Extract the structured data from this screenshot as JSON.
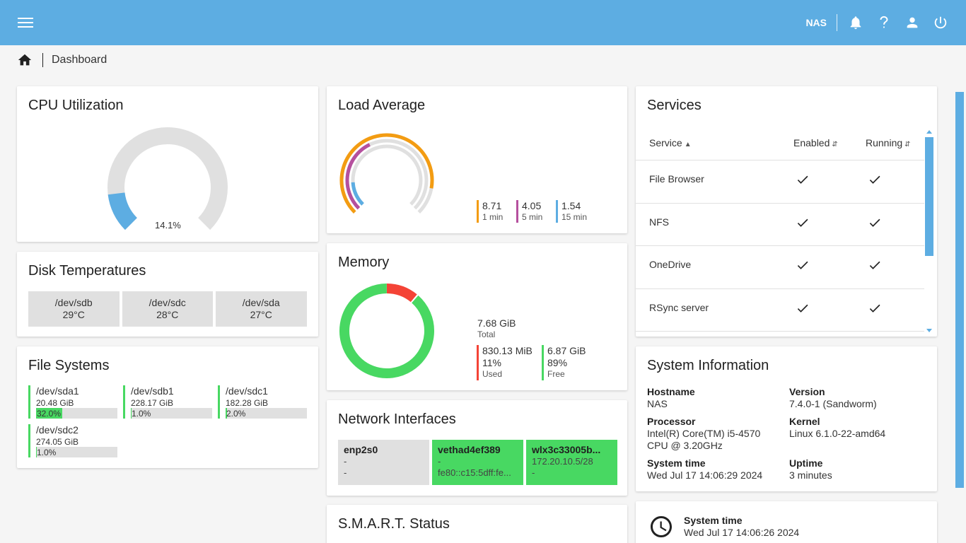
{
  "topbar": {
    "hostname": "NAS",
    "icons": [
      "menu-icon",
      "bell-icon",
      "help-icon",
      "user-icon",
      "power-icon"
    ]
  },
  "breadcrumb": {
    "home_icon": "home-icon",
    "page": "Dashboard"
  },
  "cpu": {
    "title": "CPU Utilization",
    "value_label": "14.1%",
    "value": 14.1
  },
  "load": {
    "title": "Load Average",
    "items": [
      {
        "value": "8.71",
        "label": "1 min",
        "color": "#f39c12"
      },
      {
        "value": "4.05",
        "label": "5 min",
        "color": "#b5509e"
      },
      {
        "value": "1.54",
        "label": "15 min",
        "color": "#5dade2"
      }
    ]
  },
  "memory": {
    "title": "Memory",
    "total": "7.68 GiB",
    "total_label": "Total",
    "used": "830.13 MiB",
    "used_pct": "11%",
    "used_label": "Used",
    "free": "6.87 GiB",
    "free_pct": "89%",
    "free_label": "Free",
    "used_fraction": 0.11,
    "colors": {
      "used": "#f44336",
      "free": "#48d862"
    }
  },
  "disk_temps": {
    "title": "Disk Temperatures",
    "items": [
      {
        "device": "/dev/sdb",
        "temp": "29°C"
      },
      {
        "device": "/dev/sdc",
        "temp": "28°C"
      },
      {
        "device": "/dev/sda",
        "temp": "27°C"
      }
    ]
  },
  "filesystems": {
    "title": "File Systems",
    "items": [
      {
        "device": "/dev/sda1",
        "size": "20.48 GiB",
        "pct": "32.0%",
        "fraction": 0.32
      },
      {
        "device": "/dev/sdb1",
        "size": "228.17 GiB",
        "pct": "1.0%",
        "fraction": 0.01
      },
      {
        "device": "/dev/sdc1",
        "size": "182.28 GiB",
        "pct": "2.0%",
        "fraction": 0.02
      },
      {
        "device": "/dev/sdc2",
        "size": "274.05 GiB",
        "pct": "1.0%",
        "fraction": 0.01
      }
    ]
  },
  "network": {
    "title": "Network Interfaces",
    "items": [
      {
        "name": "enp2s0",
        "line1": "-",
        "line2": "-",
        "status": "down"
      },
      {
        "name": "vethad4ef389",
        "line1": "-",
        "line2": "fe80::c15:5dff:fe...",
        "status": "up"
      },
      {
        "name": "wlx3c33005b...",
        "line1": "172.20.10.5/28",
        "line2": "-",
        "status": "up"
      }
    ],
    "colors": {
      "up": "#48d862",
      "down": "#e0e0e0"
    }
  },
  "smart": {
    "title": "S.M.A.R.T. Status"
  },
  "services": {
    "title": "Services",
    "headers": {
      "service": "Service",
      "enabled": "Enabled",
      "running": "Running"
    },
    "rows": [
      {
        "name": "File Browser",
        "enabled": true,
        "running": true
      },
      {
        "name": "NFS",
        "enabled": true,
        "running": true
      },
      {
        "name": "OneDrive",
        "enabled": true,
        "running": true
      },
      {
        "name": "RSync server",
        "enabled": true,
        "running": true
      }
    ]
  },
  "sysinfo": {
    "title": "System Information",
    "hostname_label": "Hostname",
    "hostname": "NAS",
    "version_label": "Version",
    "version": "7.4.0-1 (Sandworm)",
    "processor_label": "Processor",
    "processor_line1": "Intel(R) Core(TM) i5-4570",
    "processor_line2": "CPU @ 3.20GHz",
    "kernel_label": "Kernel",
    "kernel": "Linux 6.1.0-22-amd64",
    "time_label": "System time",
    "time": "Wed Jul 17 14:06:29 2024",
    "uptime_label": "Uptime",
    "uptime": "3 minutes"
  },
  "systime": {
    "label": "System time",
    "value": "Wed Jul 17 14:06:26 2024",
    "icon": "clock-icon"
  }
}
